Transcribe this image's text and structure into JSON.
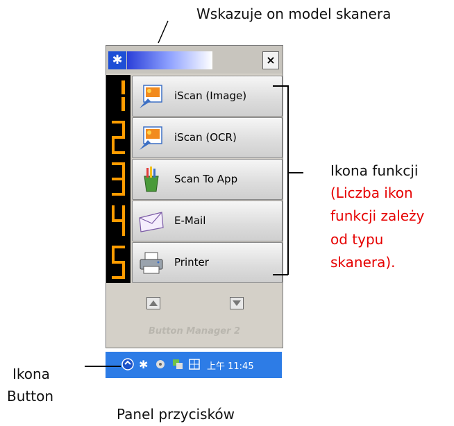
{
  "annotations": {
    "model_label": "Wskazuje on model skanera",
    "function_icon_title": "Ikona funkcji",
    "function_icon_note": [
      "(Liczba ikon",
      "funkcji zależy",
      "od typu",
      "skanera)."
    ],
    "button_icon_label": [
      "Ikona",
      "Button"
    ],
    "panel_caption": "Panel przycisków"
  },
  "window": {
    "close_glyph": "×",
    "buttons": [
      {
        "number": "1",
        "label": "iScan (Image)",
        "icon": "iscan-image-icon"
      },
      {
        "number": "2",
        "label": "iScan (OCR)",
        "icon": "iscan-ocr-icon"
      },
      {
        "number": "3",
        "label": "Scan To App",
        "icon": "scan-to-app-icon"
      },
      {
        "number": "4",
        "label": "E-Mail",
        "icon": "email-icon"
      },
      {
        "number": "5",
        "label": "Printer",
        "icon": "printer-icon"
      }
    ],
    "footer_label": "Button Manager 2"
  },
  "taskbar": {
    "time": "上午 11:45"
  },
  "colors": {
    "digit_segment": "#ff9c00",
    "taskbar": "#2d7ce6",
    "note_red": "#e60000"
  }
}
